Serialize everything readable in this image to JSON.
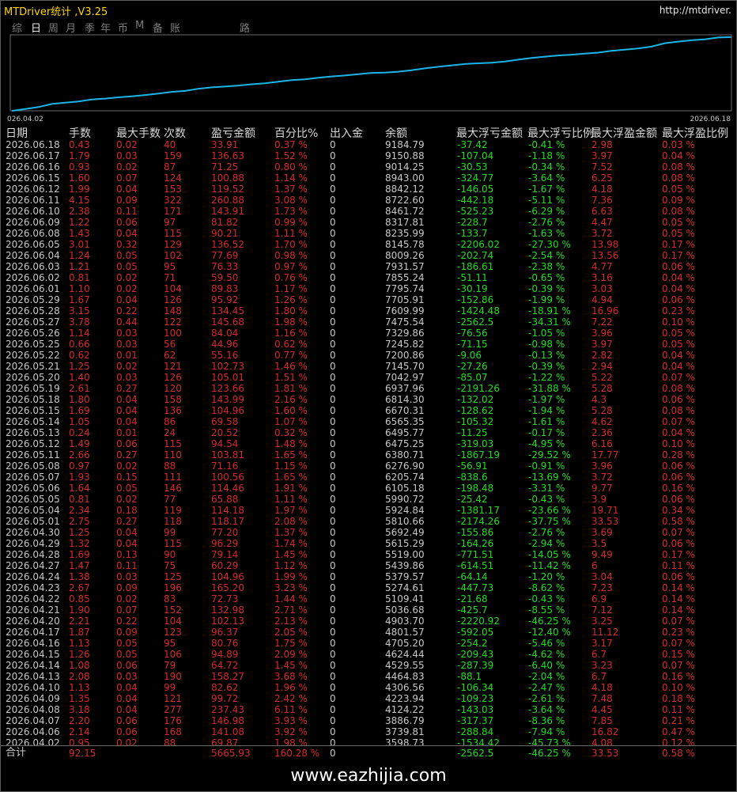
{
  "window": {
    "title": "MTDriver统计 ,V3.25",
    "url": "http://mtdriver."
  },
  "tabs": [
    {
      "label": "综",
      "active": false
    },
    {
      "label": "日",
      "active": true
    },
    {
      "label": "周",
      "active": false
    },
    {
      "label": "月",
      "active": false
    },
    {
      "label": "季",
      "active": false
    },
    {
      "label": "年",
      "active": false
    },
    {
      "label": "币",
      "active": false
    },
    {
      "label": "M",
      "active": false
    },
    {
      "label": "备",
      "active": false
    },
    {
      "label": "账户",
      "active": false
    },
    {
      "label": "路径",
      "active": false
    }
  ],
  "chart_data": {
    "type": "line",
    "x_start_label": "026.04.02",
    "x_end_label": "2026.06.18",
    "color": "#1ab4e8",
    "x": [
      "2026.04.02",
      "2026.04.06",
      "2026.04.07",
      "2026.04.08",
      "2026.04.09",
      "2026.04.10",
      "2026.04.13",
      "2026.04.14",
      "2026.04.15",
      "2026.04.16",
      "2026.04.17",
      "2026.04.20",
      "2026.04.21",
      "2026.04.22",
      "2026.04.23",
      "2026.04.24",
      "2026.04.27",
      "2026.04.28",
      "2026.04.29",
      "2026.04.30",
      "2026.05.01",
      "2026.05.04",
      "2026.05.05",
      "2026.05.06",
      "2026.05.07",
      "2026.05.08",
      "2026.05.11",
      "2026.05.12",
      "2026.05.13",
      "2026.05.14",
      "2026.05.15",
      "2026.05.18",
      "2026.05.19",
      "2026.05.20",
      "2026.05.21",
      "2026.05.22",
      "2026.05.25",
      "2026.05.26",
      "2026.05.27",
      "2026.05.28",
      "2026.05.29",
      "2026.06.01",
      "2026.06.02",
      "2026.06.03",
      "2026.06.04",
      "2026.06.05",
      "2026.06.08",
      "2026.06.09",
      "2026.06.10",
      "2026.06.11",
      "2026.06.12",
      "2026.06.15",
      "2026.06.16",
      "2026.06.17",
      "2026.06.18"
    ],
    "values": [
      3598.73,
      3739.81,
      3886.79,
      4124.22,
      4223.94,
      4306.56,
      4464.83,
      4529.55,
      4624.44,
      4705.2,
      4801.57,
      4903.7,
      5036.68,
      5109.41,
      5274.61,
      5379.57,
      5439.86,
      5519.0,
      5615.29,
      5692.49,
      5810.66,
      5924.84,
      5990.72,
      6105.18,
      6205.74,
      6276.9,
      6380.71,
      6475.25,
      6495.77,
      6565.35,
      6670.31,
      6814.3,
      6937.96,
      7042.97,
      7145.7,
      7200.86,
      7245.82,
      7329.86,
      7475.54,
      7609.99,
      7705.91,
      7795.74,
      7855.24,
      7931.57,
      8009.26,
      8145.78,
      8235.99,
      8317.81,
      8461.72,
      8722.6,
      8842.12,
      8943.0,
      9014.25,
      9150.88,
      9184.79
    ]
  },
  "table": {
    "headers": [
      "日期",
      "手数",
      "最大手数",
      "次数",
      "盈亏金额",
      "百分比%",
      "出入金",
      "余额",
      "最大浮亏金额",
      "最大浮亏比例",
      "最大浮盈金额",
      "最大浮盈比例"
    ],
    "rows": [
      [
        "2026.06.18",
        "0.43",
        "0.02",
        "40",
        "33.91",
        "0.37 %",
        "0",
        "9184.79",
        "-37.42",
        "-0.41 %",
        "2.98",
        "0.03 %"
      ],
      [
        "2026.06.17",
        "1.79",
        "0.03",
        "159",
        "136.63",
        "1.52 %",
        "0",
        "9150.88",
        "-107.04",
        "-1.18 %",
        "3.97",
        "0.04 %"
      ],
      [
        "2026.06.16",
        "0.93",
        "0.02",
        "87",
        "71.25",
        "0.80 %",
        "0",
        "9014.25",
        "-30.53",
        "-0.34 %",
        "7.52",
        "0.08 %"
      ],
      [
        "2026.06.15",
        "1.60",
        "0.07",
        "124",
        "100.88",
        "1.14 %",
        "0",
        "8943.00",
        "-324.77",
        "-3.64 %",
        "6.25",
        "0.08 %"
      ],
      [
        "2026.06.12",
        "1.99",
        "0.04",
        "153",
        "119.52",
        "1.37 %",
        "0",
        "8842.12",
        "-146.05",
        "-1.67 %",
        "4.18",
        "0.05 %"
      ],
      [
        "2026.06.11",
        "4.15",
        "0.09",
        "322",
        "260.88",
        "3.08 %",
        "0",
        "8722.60",
        "-442.18",
        "-5.11 %",
        "7.36",
        "0.09 %"
      ],
      [
        "2026.06.10",
        "2.38",
        "0.11",
        "171",
        "143.91",
        "1.73 %",
        "0",
        "8461.72",
        "-525.23",
        "-6.29 %",
        "6.63",
        "0.08 %"
      ],
      [
        "2026.06.09",
        "1.22",
        "0.06",
        "97",
        "81.82",
        "0.99 %",
        "0",
        "8317.81",
        "-228.7",
        "-2.76 %",
        "4.47",
        "0.05 %"
      ],
      [
        "2026.06.08",
        "1.43",
        "0.04",
        "115",
        "90.21",
        "1.11 %",
        "0",
        "8235.99",
        "-133.7",
        "-1.63 %",
        "3.72",
        "0.05 %"
      ],
      [
        "2026.06.05",
        "3.01",
        "0.32",
        "129",
        "136.52",
        "1.70 %",
        "0",
        "8145.78",
        "-2206.02",
        "-27.30 %",
        "13.98",
        "0.17 %"
      ],
      [
        "2026.06.04",
        "1.24",
        "0.05",
        "102",
        "77.69",
        "0.98 %",
        "0",
        "8009.26",
        "-202.74",
        "-2.54 %",
        "13.56",
        "0.17 %"
      ],
      [
        "2026.06.03",
        "1.21",
        "0.05",
        "95",
        "76.33",
        "0.97 %",
        "0",
        "7931.57",
        "-186.61",
        "-2.38 %",
        "4.77",
        "0.06 %"
      ],
      [
        "2026.06.02",
        "0.81",
        "0.02",
        "71",
        "59.50",
        "0.76 %",
        "0",
        "7855.24",
        "-51.11",
        "-0.65 %",
        "3.16",
        "0.04 %"
      ],
      [
        "2026.06.01",
        "1.10",
        "0.02",
        "104",
        "89.83",
        "1.17 %",
        "0",
        "7795.74",
        "-30.19",
        "-0.39 %",
        "3.03",
        "0.04 %"
      ],
      [
        "2026.05.29",
        "1.67",
        "0.04",
        "126",
        "95.92",
        "1.26 %",
        "0",
        "7705.91",
        "-152.86",
        "-1.99 %",
        "4.94",
        "0.06 %"
      ],
      [
        "2026.05.28",
        "3.15",
        "0.22",
        "148",
        "134.45",
        "1.80 %",
        "0",
        "7609.99",
        "-1424.48",
        "-18.91 %",
        "16.96",
        "0.23 %"
      ],
      [
        "2026.05.27",
        "3.78",
        "0.44",
        "122",
        "145.68",
        "1.98 %",
        "0",
        "7475.54",
        "-2562.5",
        "-34.31 %",
        "7.22",
        "0.10 %"
      ],
      [
        "2026.05.26",
        "1.14",
        "0.03",
        "100",
        "84.04",
        "1.16 %",
        "0",
        "7329.86",
        "-76.56",
        "-1.05 %",
        "3.96",
        "0.05 %"
      ],
      [
        "2026.05.25",
        "0.66",
        "0.03",
        "56",
        "44.96",
        "0.62 %",
        "0",
        "7245.82",
        "-71.15",
        "-0.98 %",
        "3.97",
        "0.05 %"
      ],
      [
        "2026.05.22",
        "0.62",
        "0.01",
        "62",
        "55.16",
        "0.77 %",
        "0",
        "7200.86",
        "-9.06",
        "-0.13 %",
        "2.82",
        "0.04 %"
      ],
      [
        "2026.05.21",
        "1.25",
        "0.02",
        "121",
        "102.73",
        "1.46 %",
        "0",
        "7145.70",
        "-27.26",
        "-0.39 %",
        "2.94",
        "0.04 %"
      ],
      [
        "2026.05.20",
        "1.40",
        "0.03",
        "126",
        "105.01",
        "1.51 %",
        "0",
        "7042.97",
        "-85.07",
        "-1.22 %",
        "5.22",
        "0.07 %"
      ],
      [
        "2026.05.19",
        "2.61",
        "0.27",
        "120",
        "123.66",
        "1.81 %",
        "0",
        "6937.96",
        "-2191.26",
        "-31.88 %",
        "5.28",
        "0.08 %"
      ],
      [
        "2026.05.18",
        "1.80",
        "0.04",
        "158",
        "143.99",
        "2.16 %",
        "0",
        "6814.30",
        "-132.02",
        "-1.97 %",
        "4.3",
        "0.06 %"
      ],
      [
        "2026.05.15",
        "1.69",
        "0.04",
        "136",
        "104.96",
        "1.60 %",
        "0",
        "6670.31",
        "-128.62",
        "-1.94 %",
        "5.28",
        "0.08 %"
      ],
      [
        "2026.05.14",
        "1.05",
        "0.04",
        "86",
        "69.58",
        "1.07 %",
        "0",
        "6565.35",
        "-105.32",
        "-1.61 %",
        "4.62",
        "0.07 %"
      ],
      [
        "2026.05.13",
        "0.24",
        "0.01",
        "24",
        "20.52",
        "0.32 %",
        "0",
        "6495.77",
        "-11.25",
        "-0.17 %",
        "2.36",
        "0.04 %"
      ],
      [
        "2026.05.12",
        "1.49",
        "0.06",
        "115",
        "94.54",
        "1.48 %",
        "0",
        "6475.25",
        "-319.03",
        "-4.95 %",
        "6.16",
        "0.10 %"
      ],
      [
        "2026.05.11",
        "2.66",
        "0.27",
        "110",
        "103.81",
        "1.65 %",
        "0",
        "6380.71",
        "-1867.19",
        "-29.52 %",
        "17.77",
        "0.28 %"
      ],
      [
        "2026.05.08",
        "0.97",
        "0.02",
        "88",
        "71.16",
        "1.15 %",
        "0",
        "6276.90",
        "-56.91",
        "-0.91 %",
        "3.96",
        "0.06 %"
      ],
      [
        "2026.05.07",
        "1.93",
        "0.15",
        "111",
        "100.56",
        "1.65 %",
        "0",
        "6205.74",
        "-838.6",
        "-13.69 %",
        "3.72",
        "0.06 %"
      ],
      [
        "2026.05.06",
        "1.64",
        "0.05",
        "146",
        "114.46",
        "1.91 %",
        "0",
        "6105.18",
        "-198.48",
        "-3.31 %",
        "9.77",
        "0.16 %"
      ],
      [
        "2026.05.05",
        "0.81",
        "0.02",
        "77",
        "65.88",
        "1.11 %",
        "0",
        "5990.72",
        "-25.42",
        "-0.43 %",
        "3.9",
        "0.06 %"
      ],
      [
        "2026.05.04",
        "2.34",
        "0.18",
        "119",
        "114.18",
        "1.97 %",
        "0",
        "5924.84",
        "-1381.17",
        "-23.66 %",
        "19.71",
        "0.34 %"
      ],
      [
        "2026.05.01",
        "2.75",
        "0.27",
        "118",
        "118.17",
        "2.08 %",
        "0",
        "5810.66",
        "-2174.26",
        "-37.75 %",
        "33.53",
        "0.58 %"
      ],
      [
        "2026.04.30",
        "1.25",
        "0.04",
        "99",
        "77.20",
        "1.37 %",
        "0",
        "5692.49",
        "-155.86",
        "-2.76 %",
        "3.69",
        "0.07 %"
      ],
      [
        "2026.04.29",
        "1.32",
        "0.04",
        "115",
        "96.29",
        "1.74 %",
        "0",
        "5615.29",
        "-164.26",
        "-2.94 %",
        "3.5",
        "0.06 %"
      ],
      [
        "2026.04.28",
        "1.69",
        "0.13",
        "90",
        "79.14",
        "1.45 %",
        "0",
        "5519.00",
        "-771.51",
        "-14.05 %",
        "9.49",
        "0.17 %"
      ],
      [
        "2026.04.27",
        "1.47",
        "0.11",
        "75",
        "60.29",
        "1.12 %",
        "0",
        "5439.86",
        "-614.51",
        "-11.42 %",
        "6",
        "0.11 %"
      ],
      [
        "2026.04.24",
        "1.38",
        "0.03",
        "125",
        "104.96",
        "1.99 %",
        "0",
        "5379.57",
        "-64.14",
        "-1.20 %",
        "3.04",
        "0.06 %"
      ],
      [
        "2026.04.23",
        "2.67",
        "0.09",
        "196",
        "165.20",
        "3.23 %",
        "0",
        "5274.61",
        "-447.73",
        "-8.62 %",
        "7.23",
        "0.14 %"
      ],
      [
        "2026.04.22",
        "0.85",
        "0.02",
        "83",
        "72.73",
        "1.44 %",
        "0",
        "5109.41",
        "-21.68",
        "-0.43 %",
        "6.9",
        "0.14 %"
      ],
      [
        "2026.04.21",
        "1.90",
        "0.07",
        "152",
        "132.98",
        "2.71 %",
        "0",
        "5036.68",
        "-425.7",
        "-8.55 %",
        "7.12",
        "0.14 %"
      ],
      [
        "2026.04.20",
        "2.21",
        "0.22",
        "104",
        "102.13",
        "2.13 %",
        "0",
        "4903.70",
        "-2220.92",
        "-46.25 %",
        "3.25",
        "0.07 %"
      ],
      [
        "2026.04.17",
        "1.87",
        "0.09",
        "123",
        "96.37",
        "2.05 %",
        "0",
        "4801.57",
        "-592.05",
        "-12.40 %",
        "11.12",
        "0.23 %"
      ],
      [
        "2026.04.16",
        "1.13",
        "0.05",
        "95",
        "80.76",
        "1.75 %",
        "0",
        "4705.20",
        "-254.2",
        "-5.46 %",
        "3.17",
        "0.07 %"
      ],
      [
        "2026.04.15",
        "1.26",
        "0.05",
        "106",
        "94.89",
        "2.09 %",
        "0",
        "4624.44",
        "-209.43",
        "-4.62 %",
        "6.7",
        "0.15 %"
      ],
      [
        "2026.04.14",
        "1.08",
        "0.06",
        "79",
        "64.72",
        "1.45 %",
        "0",
        "4529.55",
        "-287.39",
        "-6.40 %",
        "3.23",
        "0.07 %"
      ],
      [
        "2026.04.13",
        "2.08",
        "0.03",
        "190",
        "158.27",
        "3.68 %",
        "0",
        "4464.83",
        "-88.1",
        "-2.04 %",
        "6.7",
        "0.16 %"
      ],
      [
        "2026.04.10",
        "1.13",
        "0.04",
        "99",
        "82.62",
        "1.96 %",
        "0",
        "4306.56",
        "-106.34",
        "-2.47 %",
        "4.18",
        "0.10 %"
      ],
      [
        "2026.04.09",
        "1.35",
        "0.04",
        "121",
        "99.72",
        "2.42 %",
        "0",
        "4223.94",
        "-109.23",
        "-2.61 %",
        "7.48",
        "0.18 %"
      ],
      [
        "2026.04.08",
        "3.18",
        "0.04",
        "277",
        "237.43",
        "6.11 %",
        "0",
        "4124.22",
        "-143.03",
        "-3.64 %",
        "4.45",
        "0.11 %"
      ],
      [
        "2026.04.07",
        "2.20",
        "0.06",
        "176",
        "146.98",
        "3.93 %",
        "0",
        "3886.79",
        "-317.37",
        "-8.36 %",
        "7.85",
        "0.21 %"
      ],
      [
        "2026.04.06",
        "2.14",
        "0.06",
        "168",
        "141.08",
        "3.92 %",
        "0",
        "3739.81",
        "-288.84",
        "-7.94 %",
        "16.82",
        "0.47 %"
      ],
      [
        "2026.04.02",
        "0.95",
        "0.02",
        "88",
        "69.87",
        "1.98 %",
        "0",
        "3598.73",
        "-1534.42",
        "-45.73 %",
        "4.08",
        "0.12 %"
      ]
    ],
    "total": {
      "label": "合计",
      "lots": "92.15",
      "max_lots": "",
      "count": "",
      "profit": "5665.93",
      "percent": "160.28 %",
      "deposit": "0",
      "balance": "",
      "max_loss": "-2562.5",
      "max_loss_pct": "-46.25 %",
      "max_gain": "33.53",
      "max_gain_pct": "0.58 %"
    }
  },
  "watermark": "www.eazhijia.com"
}
